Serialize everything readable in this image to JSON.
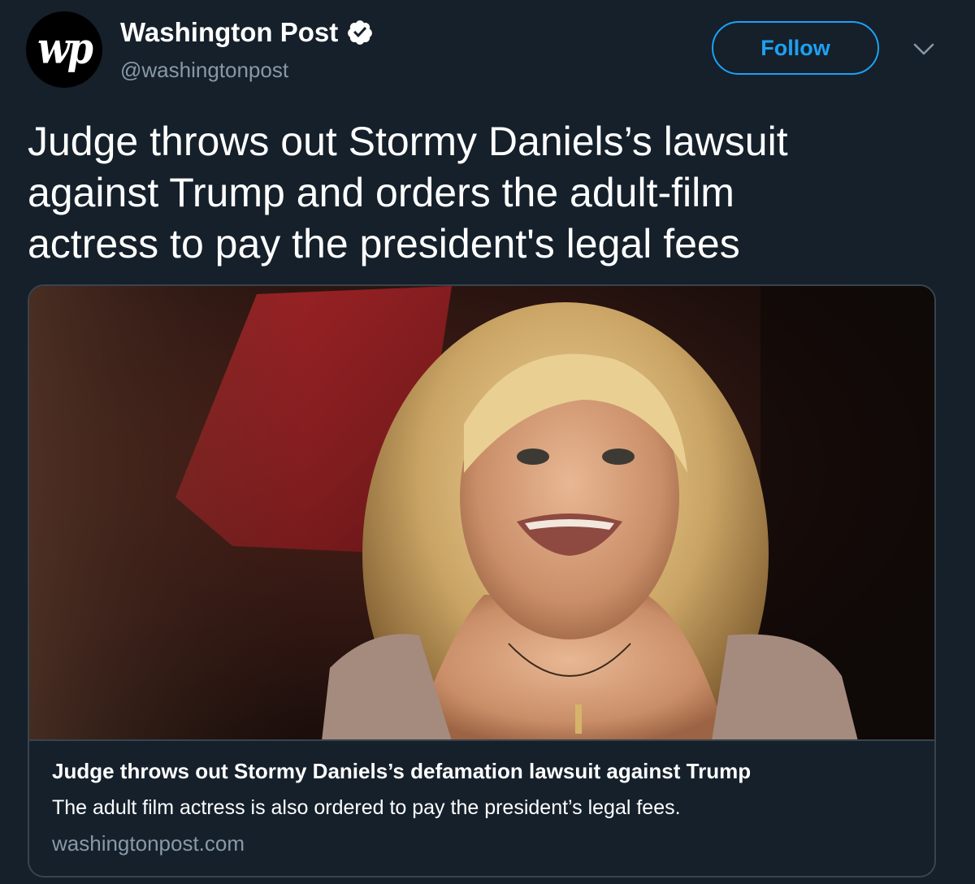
{
  "tweet": {
    "author": {
      "logo_text": "wp",
      "display_name": "Washington Post",
      "handle": "@washingtonpost",
      "verified": true
    },
    "follow_label": "Follow",
    "text": "Judge throws out Stormy Daniels’s lawsuit\nagainst Trump and orders the adult-film\nactress to pay the president's legal fees",
    "card": {
      "title": "Judge throws out Stormy Daniels’s defamation lawsuit against Trump",
      "description": "The adult film actress is also ordered to pay the president’s legal fees.",
      "domain": "washingtonpost.com"
    }
  },
  "colors": {
    "background": "#15202b",
    "accent": "#1da1f2",
    "secondary_text": "#8899a6",
    "border": "#38444d"
  },
  "icons": {
    "verified": "verified-badge-icon",
    "menu": "chevron-down-icon"
  }
}
